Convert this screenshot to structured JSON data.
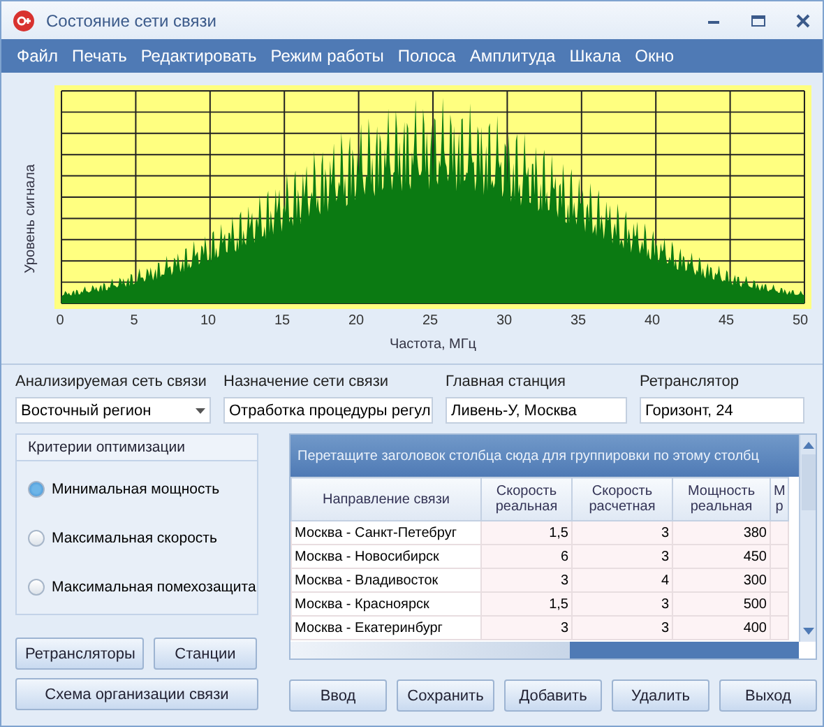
{
  "window": {
    "title": "Состояние сети связи"
  },
  "menu": [
    "Файл",
    "Печать",
    "Редактировать",
    "Режим работы",
    "Полоса",
    "Амплитуда",
    "Шкала",
    "Окно"
  ],
  "spectrum": {
    "ylabel": "Уровень сигнала",
    "xlabel": "Частота, МГц",
    "xticks": [
      "0",
      "5",
      "10",
      "15",
      "20",
      "25",
      "30",
      "35",
      "40",
      "45",
      "50"
    ]
  },
  "fields": [
    {
      "label": "Анализируемая сеть связи",
      "value": "Восточный регион",
      "kind": "dropdown"
    },
    {
      "label": "Назначение сети связи",
      "value": "Отработка процедуры регул",
      "kind": "text"
    },
    {
      "label": "Главная станция",
      "value": "Ливень-У, Москва",
      "kind": "text"
    },
    {
      "label": "Ретранслятор",
      "value": "Горизонт, 24",
      "kind": "text"
    }
  ],
  "criteria": {
    "title": "Критерии оптимизации",
    "options": [
      {
        "label": "Минимальная мощность",
        "selected": true
      },
      {
        "label": "Максимальная скорость",
        "selected": false
      },
      {
        "label": "Максимальная помехозащита",
        "selected": false
      }
    ]
  },
  "side_buttons": [
    "Ретрансляторы",
    "Станции",
    "Схема организации связи"
  ],
  "grid": {
    "group_hint": "Перетащите заголовок столбца сюда для группировки по этому столбц",
    "columns": [
      "Направление связи",
      "Скорость реальная",
      "Скорость расчетная",
      "Мощность реальная",
      "М р"
    ],
    "rows": [
      [
        "Москва - Санкт-Петебруг",
        "1,5",
        "3",
        "380"
      ],
      [
        "Москва - Новосибирск",
        "6",
        "3",
        "450"
      ],
      [
        "Москва - Владивосток",
        "3",
        "4",
        "300"
      ],
      [
        "Москва - Красноярск",
        "1,5",
        "3",
        "500"
      ],
      [
        "Москва - Екатеринбург",
        "3",
        "3",
        "400"
      ]
    ]
  },
  "buttons": [
    "Ввод",
    "Сохранить",
    "Добавить",
    "Удалить",
    "Выход"
  ]
}
